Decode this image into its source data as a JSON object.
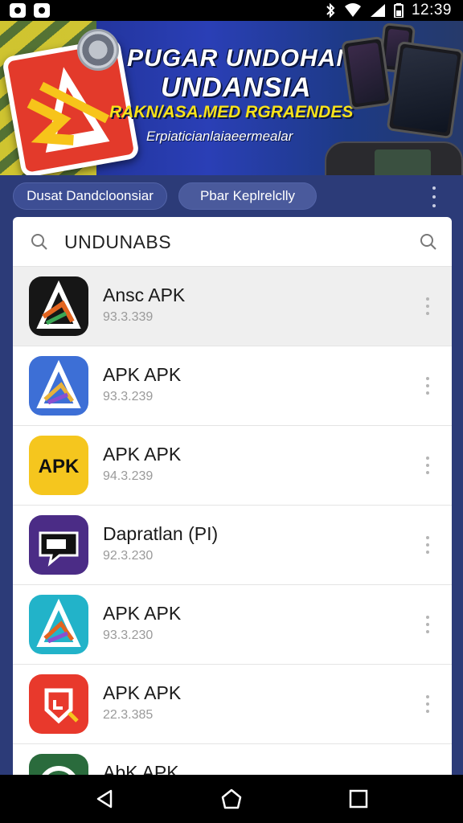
{
  "status_bar": {
    "time": "12:39"
  },
  "banner": {
    "title_line1": "PUGAR UNDOHAN",
    "title_line2": "UNDANSIA",
    "subtitle": "RAKN/ASA.MED RGRAENDES",
    "tagline": "Erpiaticianlaiaeermealar"
  },
  "chips": {
    "chip1": "Dusat Dandcloonsiar",
    "chip2": "Pbar Keplrelclly"
  },
  "search": {
    "value": "UNDUNABS"
  },
  "apps": [
    {
      "name": "Ansc APK",
      "version": "93.3.339"
    },
    {
      "name": "APK APK",
      "version": "93.3.239"
    },
    {
      "name": "APK APK",
      "version": "94.3.239"
    },
    {
      "name": "Dapratlan (PI)",
      "version": "92.3.230"
    },
    {
      "name": "APK APK",
      "version": "93.3.230"
    },
    {
      "name": "APK APK",
      "version": "22.3.385"
    },
    {
      "name": "AbK APK",
      "version": ""
    }
  ],
  "icons": {
    "app1": "dark-triangle-icon",
    "app2": "blue-triangle-icon",
    "app3": "apk-yellow-icon",
    "app4": "purple-chat-icon",
    "app5": "teal-triangle-icon",
    "app6": "red-badge-icon",
    "app7": "green-circle-icon"
  },
  "colors": {
    "banner_bg": "#2a3fb6",
    "chip_bg": "#3d4e94",
    "card_bg": "#ffffff",
    "highlight_row": "#efefef"
  }
}
